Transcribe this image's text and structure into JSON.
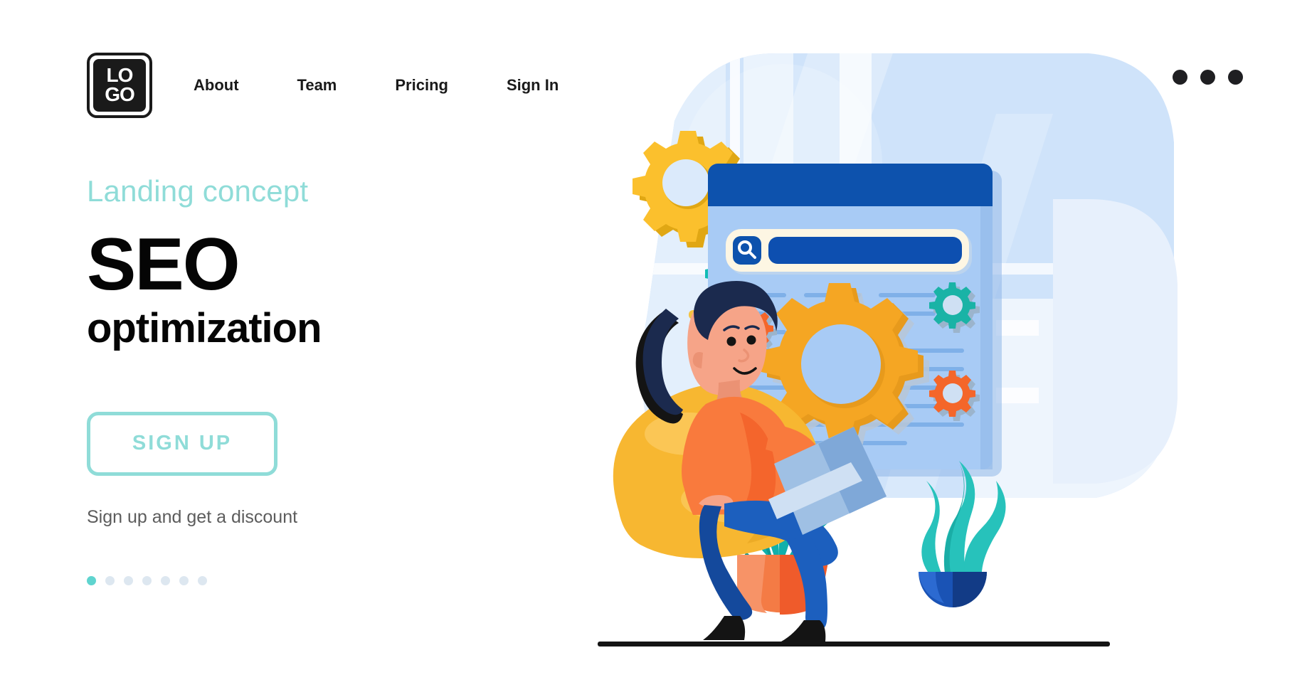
{
  "header": {
    "logo_line1": "LO",
    "logo_line2": "GO",
    "logo_name": "logo",
    "nav": [
      {
        "label": "About"
      },
      {
        "label": "Team"
      },
      {
        "label": "Pricing"
      },
      {
        "label": "Sign In"
      }
    ],
    "menu_icon": "more-horizontal-icon"
  },
  "hero": {
    "eyebrow": "Landing concept",
    "title_main": "SEO",
    "title_sub": "optimization",
    "cta_label": "SIGN UP",
    "note": "Sign up and get a discount",
    "pagination": {
      "total": 7,
      "active_index": 0
    }
  },
  "illustration": {
    "name": "seo-optimization-illustration",
    "scene": "woman sitting on beanbag with laptop in front of a search browser window with gears",
    "search_icon": "magnifier-icon",
    "search_value": "",
    "gears": [
      {
        "name": "gear-yellow-large",
        "color": "#fbc02d"
      },
      {
        "name": "gear-teal-small",
        "color": "#11bcb4"
      },
      {
        "name": "gear-orange-main",
        "color": "#f5a623"
      },
      {
        "name": "gear-orange-small-left",
        "color": "#f4662a"
      },
      {
        "name": "gear-blue-small",
        "color": "#1257b0"
      },
      {
        "name": "gear-teal-right",
        "color": "#1ab3a6"
      },
      {
        "name": "gear-orange-right",
        "color": "#f4662a"
      }
    ],
    "plants": [
      {
        "name": "plant-orange-pot",
        "pot": "#f47b45",
        "leaves": "#12b0ab"
      },
      {
        "name": "plant-blue-pot",
        "pot": "#1a53b5",
        "leaves": "#27c2bb"
      }
    ]
  },
  "colors": {
    "accent_teal": "#8fdcd8",
    "ink": "#050505",
    "muted": "#5c5c5c",
    "browser_header": "#0d52ad",
    "browser_body": "#a8cbf5",
    "search_tray": "#fdf6e3",
    "blob": "#cfe3fa",
    "beanbag": "#f7b731",
    "sweater": "#f97a3d",
    "jeans": "#1c5fbe",
    "hair": "#1b2a4e",
    "skin": "#f6a488"
  }
}
